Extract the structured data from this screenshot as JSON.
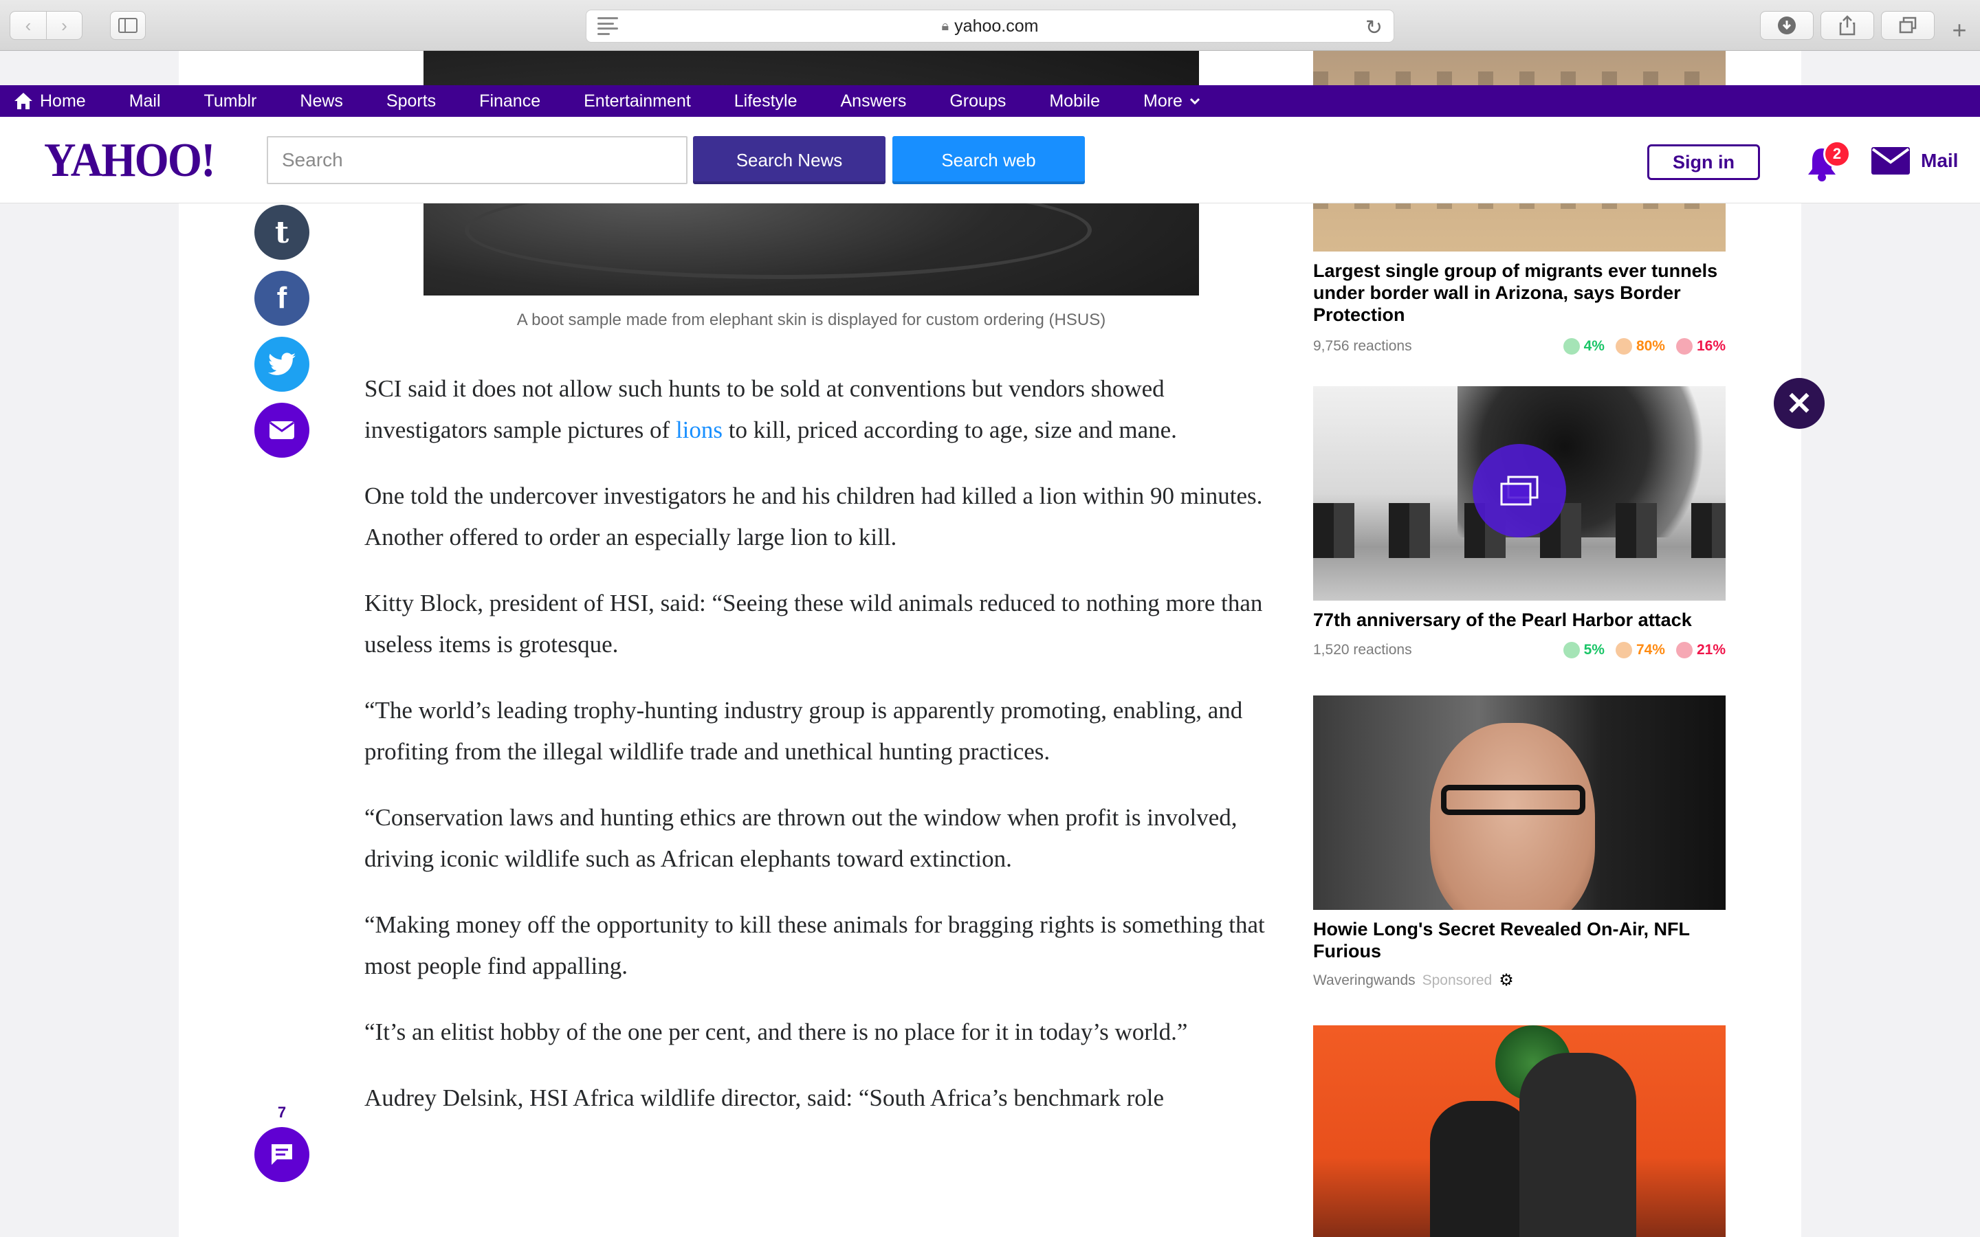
{
  "browser": {
    "url": "yahoo.com",
    "back_glyph": "‹",
    "forward_glyph": "›",
    "new_tab_glyph": "+"
  },
  "nav": {
    "items": [
      {
        "label": "Home"
      },
      {
        "label": "Mail"
      },
      {
        "label": "Tumblr"
      },
      {
        "label": "News"
      },
      {
        "label": "Sports"
      },
      {
        "label": "Finance"
      },
      {
        "label": "Entertainment"
      },
      {
        "label": "Lifestyle"
      },
      {
        "label": "Answers"
      },
      {
        "label": "Groups"
      },
      {
        "label": "Mobile"
      },
      {
        "label": "More"
      }
    ]
  },
  "header": {
    "logo_text": "YAHOO!",
    "search_placeholder": "Search",
    "search_news_label": "Search News",
    "search_web_label": "Search web",
    "signin_label": "Sign in",
    "notification_count": "2",
    "mail_label": "Mail"
  },
  "article": {
    "caption": "A boot sample made from elephant skin is displayed for custom ordering (HSUS)",
    "p1_before": "SCI said it does not allow such hunts to be sold at conventions but vendors showed investigators sample pictures of ",
    "p1_link": "lions",
    "p1_after": " to kill, priced according to age, size and mane.",
    "paragraphs": [
      "One told the undercover investigators he and his children had killed a lion within 90 minutes. Another offered to order an especially large lion to kill.",
      "Kitty Block, president of HSI, said: “Seeing these wild animals reduced to nothing more than useless items is grotesque.",
      "“The world’s leading trophy-hunting industry group is apparently promoting, enabling, and profiting from the illegal wildlife trade and unethical hunting practices.",
      "“Conservation laws and hunting ethics are thrown out the window when profit is involved, driving iconic wildlife such as African elephants toward extinction.",
      "“Making money off the opportunity to kill these animals for bragging rights is something that most people find appalling.",
      "“It’s an elitist hobby of the one per cent, and there is no place for it in today’s world.”",
      "Audrey Delsink, HSI Africa wildlife director, said: “South Africa’s benchmark role"
    ],
    "comment_count": "7"
  },
  "share": {
    "tumblr_glyph": "t",
    "facebook_glyph": "f"
  },
  "rail": {
    "story1": {
      "title": "Largest single group of migrants ever tunnels under border wall in Arizona, says Border Protection",
      "reactions_label": "9,756 reactions",
      "happy": "4%",
      "meh": "80%",
      "sad": "16%"
    },
    "story2": {
      "title": "77th anniversary of the Pearl Harbor attack",
      "reactions_label": "1,520 reactions",
      "happy": "5%",
      "meh": "74%",
      "sad": "21%"
    },
    "story3": {
      "title": "Howie Long's Secret Revealed On-Air, NFL Furious",
      "source": "Waveringwands",
      "sponsored": "Sponsored"
    }
  },
  "close_glyph": "✕",
  "colors": {
    "yahoo_purple": "#400090",
    "search_news_btn": "#3d2f93",
    "search_web_btn": "#188fff",
    "link_blue": "#188fff",
    "badge_red": "#ff1f38"
  }
}
